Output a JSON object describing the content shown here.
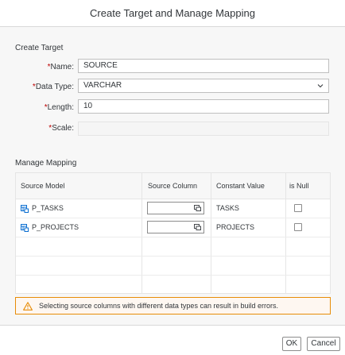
{
  "dialog": {
    "title": "Create Target and Manage Mapping"
  },
  "create_target": {
    "section_title": "Create Target",
    "required_marker": "*",
    "fields": {
      "name": {
        "label": "Name:",
        "value": "SOURCE"
      },
      "data_type": {
        "label": "Data Type:",
        "value": "VARCHAR"
      },
      "length": {
        "label": "Length:",
        "value": "10"
      },
      "scale": {
        "label": "Scale:",
        "value": ""
      }
    }
  },
  "manage_mapping": {
    "section_title": "Manage Mapping",
    "columns": {
      "source_model": "Source Model",
      "source_column": "Source Column",
      "constant_value": "Constant Value",
      "is_null": "is Null"
    },
    "rows": [
      {
        "source_model": "P_TASKS",
        "source_column": "",
        "constant_value": "TASKS",
        "is_null": false
      },
      {
        "source_model": "P_PROJECTS",
        "source_column": "",
        "constant_value": "PROJECTS",
        "is_null": false
      }
    ]
  },
  "warning": {
    "text": "Selecting source columns with different data types can result in build errors."
  },
  "footer": {
    "ok_label": "OK",
    "cancel_label": "Cancel"
  },
  "colors": {
    "required": "#bb0000",
    "warning_border": "#e78c07",
    "warning_icon": "#e78c07",
    "model_icon": "#0a6ed1"
  }
}
